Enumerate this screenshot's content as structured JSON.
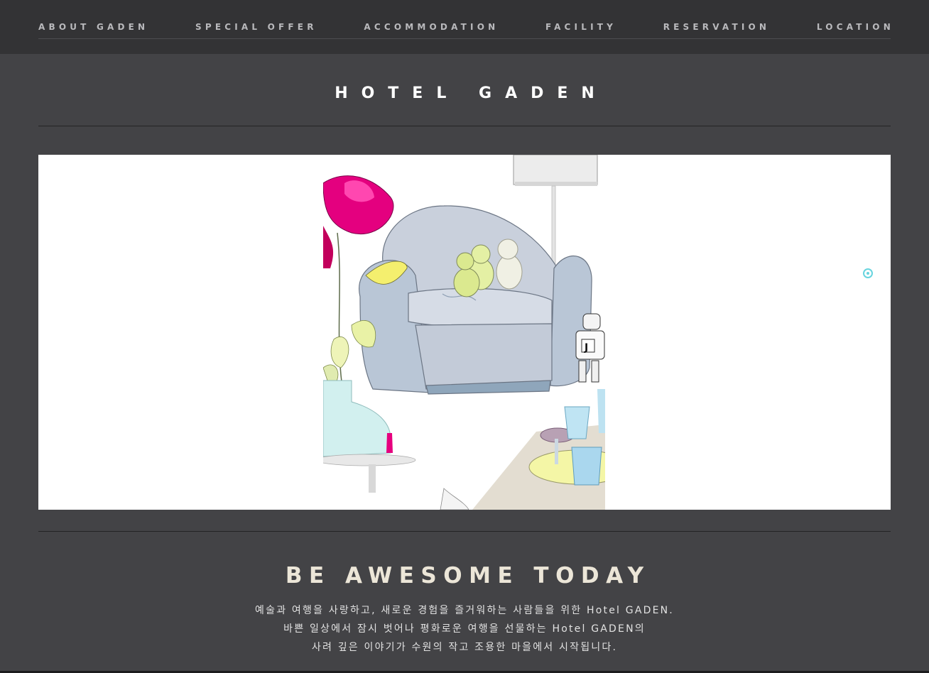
{
  "nav": {
    "items": [
      {
        "label": "ABOUT GADEN"
      },
      {
        "label": "SPECIAL OFFER"
      },
      {
        "label": "ACCOMMODATION"
      },
      {
        "label": "FACILITY"
      },
      {
        "label": "RESERVATION"
      },
      {
        "label": "LOCATION"
      }
    ]
  },
  "logo": {
    "text": "HOTEL GADEN"
  },
  "slider": {
    "image_subject": "illustration-armchair-teddy-bears-lamp-flowers",
    "pager_color": "#67d4de"
  },
  "intro": {
    "headline": "BE AWESOME TODAY",
    "lines": [
      "예술과 여행을 사랑하고, 새로운 경험을 즐거워하는 사람들을 위한 Hotel GADEN.",
      "바쁜 일상에서 잠시 벗어나 평화로운 여행을 선물하는 Hotel GADEN의",
      "사려 깊은 이야기가 수원의 작고 조용한 마을에서 시작됩니다."
    ]
  },
  "colors": {
    "page_bg": "#434346",
    "topbar_bg": "#333335",
    "nav_text": "#b9b9bc",
    "headline": "#ece6d8",
    "accent": "#67d4de"
  }
}
